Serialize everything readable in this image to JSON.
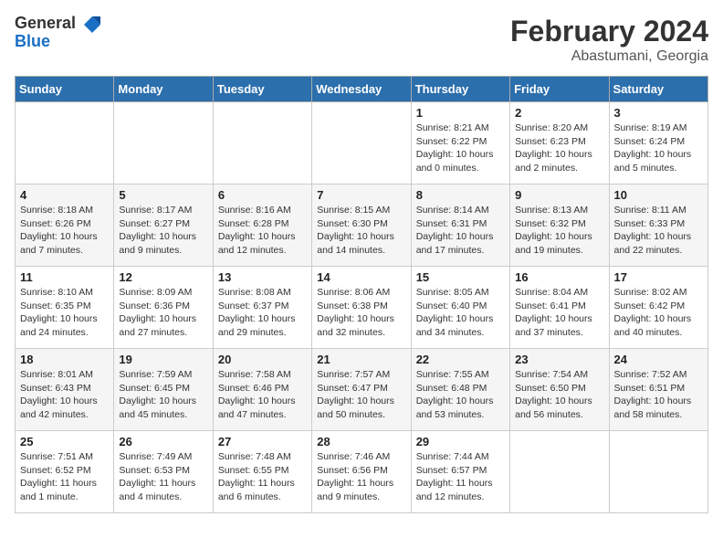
{
  "header": {
    "logo_general": "General",
    "logo_blue": "Blue",
    "month_title": "February 2024",
    "location": "Abastumani, Georgia"
  },
  "days_of_week": [
    "Sunday",
    "Monday",
    "Tuesday",
    "Wednesday",
    "Thursday",
    "Friday",
    "Saturday"
  ],
  "weeks": [
    [
      {
        "day": "",
        "info": ""
      },
      {
        "day": "",
        "info": ""
      },
      {
        "day": "",
        "info": ""
      },
      {
        "day": "",
        "info": ""
      },
      {
        "day": "1",
        "info": "Sunrise: 8:21 AM\nSunset: 6:22 PM\nDaylight: 10 hours and 0 minutes."
      },
      {
        "day": "2",
        "info": "Sunrise: 8:20 AM\nSunset: 6:23 PM\nDaylight: 10 hours and 2 minutes."
      },
      {
        "day": "3",
        "info": "Sunrise: 8:19 AM\nSunset: 6:24 PM\nDaylight: 10 hours and 5 minutes."
      }
    ],
    [
      {
        "day": "4",
        "info": "Sunrise: 8:18 AM\nSunset: 6:26 PM\nDaylight: 10 hours and 7 minutes."
      },
      {
        "day": "5",
        "info": "Sunrise: 8:17 AM\nSunset: 6:27 PM\nDaylight: 10 hours and 9 minutes."
      },
      {
        "day": "6",
        "info": "Sunrise: 8:16 AM\nSunset: 6:28 PM\nDaylight: 10 hours and 12 minutes."
      },
      {
        "day": "7",
        "info": "Sunrise: 8:15 AM\nSunset: 6:30 PM\nDaylight: 10 hours and 14 minutes."
      },
      {
        "day": "8",
        "info": "Sunrise: 8:14 AM\nSunset: 6:31 PM\nDaylight: 10 hours and 17 minutes."
      },
      {
        "day": "9",
        "info": "Sunrise: 8:13 AM\nSunset: 6:32 PM\nDaylight: 10 hours and 19 minutes."
      },
      {
        "day": "10",
        "info": "Sunrise: 8:11 AM\nSunset: 6:33 PM\nDaylight: 10 hours and 22 minutes."
      }
    ],
    [
      {
        "day": "11",
        "info": "Sunrise: 8:10 AM\nSunset: 6:35 PM\nDaylight: 10 hours and 24 minutes."
      },
      {
        "day": "12",
        "info": "Sunrise: 8:09 AM\nSunset: 6:36 PM\nDaylight: 10 hours and 27 minutes."
      },
      {
        "day": "13",
        "info": "Sunrise: 8:08 AM\nSunset: 6:37 PM\nDaylight: 10 hours and 29 minutes."
      },
      {
        "day": "14",
        "info": "Sunrise: 8:06 AM\nSunset: 6:38 PM\nDaylight: 10 hours and 32 minutes."
      },
      {
        "day": "15",
        "info": "Sunrise: 8:05 AM\nSunset: 6:40 PM\nDaylight: 10 hours and 34 minutes."
      },
      {
        "day": "16",
        "info": "Sunrise: 8:04 AM\nSunset: 6:41 PM\nDaylight: 10 hours and 37 minutes."
      },
      {
        "day": "17",
        "info": "Sunrise: 8:02 AM\nSunset: 6:42 PM\nDaylight: 10 hours and 40 minutes."
      }
    ],
    [
      {
        "day": "18",
        "info": "Sunrise: 8:01 AM\nSunset: 6:43 PM\nDaylight: 10 hours and 42 minutes."
      },
      {
        "day": "19",
        "info": "Sunrise: 7:59 AM\nSunset: 6:45 PM\nDaylight: 10 hours and 45 minutes."
      },
      {
        "day": "20",
        "info": "Sunrise: 7:58 AM\nSunset: 6:46 PM\nDaylight: 10 hours and 47 minutes."
      },
      {
        "day": "21",
        "info": "Sunrise: 7:57 AM\nSunset: 6:47 PM\nDaylight: 10 hours and 50 minutes."
      },
      {
        "day": "22",
        "info": "Sunrise: 7:55 AM\nSunset: 6:48 PM\nDaylight: 10 hours and 53 minutes."
      },
      {
        "day": "23",
        "info": "Sunrise: 7:54 AM\nSunset: 6:50 PM\nDaylight: 10 hours and 56 minutes."
      },
      {
        "day": "24",
        "info": "Sunrise: 7:52 AM\nSunset: 6:51 PM\nDaylight: 10 hours and 58 minutes."
      }
    ],
    [
      {
        "day": "25",
        "info": "Sunrise: 7:51 AM\nSunset: 6:52 PM\nDaylight: 11 hours and 1 minute."
      },
      {
        "day": "26",
        "info": "Sunrise: 7:49 AM\nSunset: 6:53 PM\nDaylight: 11 hours and 4 minutes."
      },
      {
        "day": "27",
        "info": "Sunrise: 7:48 AM\nSunset: 6:55 PM\nDaylight: 11 hours and 6 minutes."
      },
      {
        "day": "28",
        "info": "Sunrise: 7:46 AM\nSunset: 6:56 PM\nDaylight: 11 hours and 9 minutes."
      },
      {
        "day": "29",
        "info": "Sunrise: 7:44 AM\nSunset: 6:57 PM\nDaylight: 11 hours and 12 minutes."
      },
      {
        "day": "",
        "info": ""
      },
      {
        "day": "",
        "info": ""
      }
    ]
  ]
}
